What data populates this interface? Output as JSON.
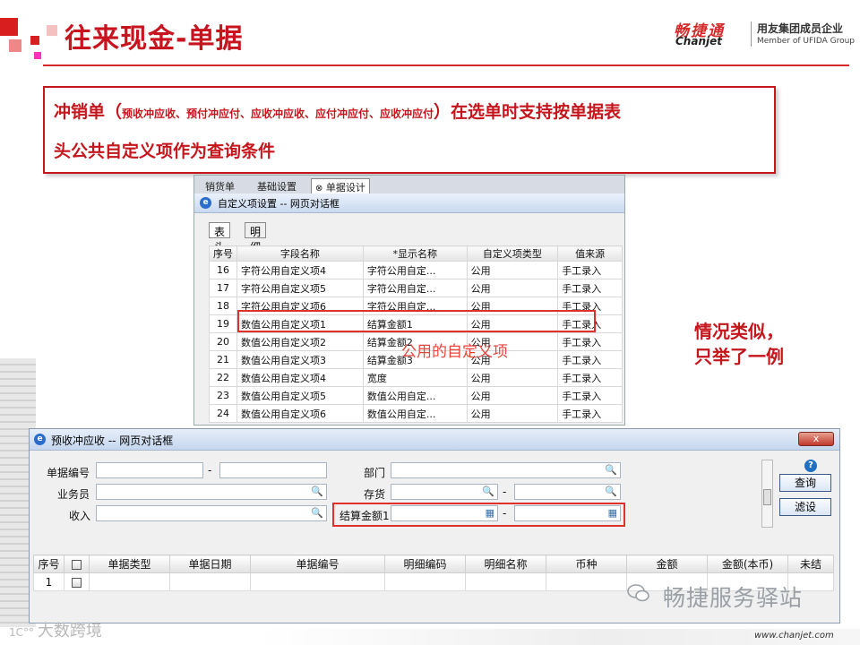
{
  "slide": {
    "title": "往来现金-单据",
    "brand": {
      "name_cn": "畅捷通",
      "name_en": "Chanjet",
      "tagline_cn": "用友集团成员企业",
      "tagline_en": "Member of UFIDA Group"
    },
    "callout": {
      "line1_prefix": "冲销单（",
      "line1_small": "预收冲应收、预付冲应付、应收冲应收、应付冲应付、应收冲应付",
      "line1_suffix": "）在选单时支持按单据表",
      "line2": "头公共自定义项作为查询条件"
    },
    "annotation_common": "公用的自定义项",
    "annotation_right_1": "情况类似，",
    "annotation_right_2": "只举了一例",
    "footer_url": "www.chanjet.com",
    "wechat_watermark": "畅捷服务驿站",
    "left_watermark": "大数跨境"
  },
  "dialog1": {
    "bg_tabs": [
      "销货单",
      "基础设置",
      "单据设计"
    ],
    "title": "自定义项设置 -- 网页对话框",
    "subtabs": [
      "表头",
      "明细"
    ],
    "columns": [
      "序号",
      "字段名称",
      "*显示名称",
      "自定义项类型",
      "值来源"
    ],
    "rows": [
      [
        "16",
        "字符公用自定义项4",
        "字符公用自定...",
        "公用",
        "手工录入"
      ],
      [
        "17",
        "字符公用自定义项5",
        "字符公用自定...",
        "公用",
        "手工录入"
      ],
      [
        "18",
        "字符公用自定义项6",
        "字符公用自定...",
        "公用",
        "手工录入"
      ],
      [
        "19",
        "数值公用自定义项1",
        "结算金额1",
        "公用",
        "手工录入"
      ],
      [
        "20",
        "数值公用自定义项2",
        "结算金额2",
        "公用",
        "手工录入"
      ],
      [
        "21",
        "数值公用自定义项3",
        "结算金额3",
        "公用",
        "手工录入"
      ],
      [
        "22",
        "数值公用自定义项4",
        "宽度",
        "公用",
        "手工录入"
      ],
      [
        "23",
        "数值公用自定义项5",
        "数值公用自定...",
        "公用",
        "手工录入"
      ],
      [
        "24",
        "数值公用自定义项6",
        "数值公用自定...",
        "公用",
        "手工录入"
      ]
    ]
  },
  "dialog2": {
    "title": "预收冲应收 -- 网页对话框",
    "close_label": "x",
    "labels": {
      "doc_no": "单据编号",
      "salesman": "业务员",
      "income": "收入",
      "dept": "部门",
      "stock": "存货",
      "settle": "结算金额1"
    },
    "dash": "-",
    "buttons": {
      "query": "查询",
      "filter": "滤设"
    },
    "help": "?",
    "columns": [
      "序号",
      "",
      "单据类型",
      "单据日期",
      "单据编号",
      "明细编码",
      "明细名称",
      "币种",
      "金额",
      "金额(本币)",
      "未结"
    ],
    "rows": [
      [
        "1"
      ]
    ]
  },
  "colors": {
    "brand_red": "#c8141e",
    "highlight_red": "#e0302c",
    "window_blue": "#c9d9f0"
  }
}
